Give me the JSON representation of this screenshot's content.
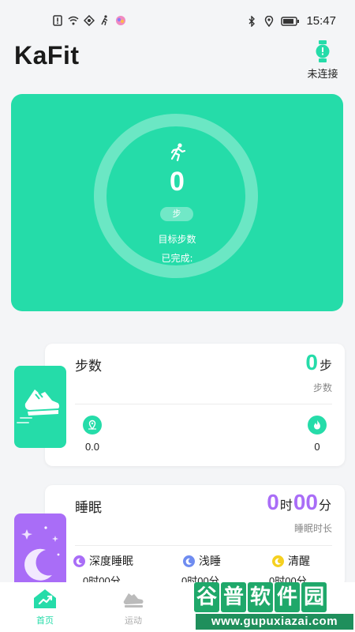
{
  "status_bar": {
    "time": "15:47",
    "icons": [
      "sim-alert-icon",
      "wifi-icon",
      "data-icon",
      "run-status-icon",
      "app-status-icon",
      "bluetooth-icon",
      "location-icon",
      "battery-icon"
    ]
  },
  "header": {
    "app_title": "KaFit",
    "device_status": "未连接",
    "device_icon": "watch-alert-icon"
  },
  "hero": {
    "steps": "0",
    "unit": "步",
    "goal_label": "目标步数",
    "completed_label": "已完成:",
    "color": "#25dca9"
  },
  "steps_card": {
    "title": "步数",
    "value": "0",
    "unit": "步",
    "sub_label": "步数",
    "distance_value": "0.0",
    "calorie_value": "0",
    "accent": "#25dca9"
  },
  "sleep_card": {
    "title": "睡眠",
    "hours": "0",
    "hour_unit": "时",
    "minutes": "00",
    "minute_unit": "分",
    "sub_label": "睡眠时长",
    "accent": "#a96df7",
    "items": [
      {
        "label": "深度睡眠",
        "value": "0时00分",
        "color": "#a96df7"
      },
      {
        "label": "浅睡",
        "value": "0时00分",
        "color": "#6f8cf0"
      },
      {
        "label": "清醒",
        "value": "0时00分",
        "color": "#f5d020"
      }
    ]
  },
  "nav": {
    "home": "首页",
    "sport": "运动"
  },
  "watermark": {
    "chars": [
      "谷",
      "普",
      "软",
      "件",
      "园"
    ],
    "url": "www.gupuxiazai.com"
  }
}
